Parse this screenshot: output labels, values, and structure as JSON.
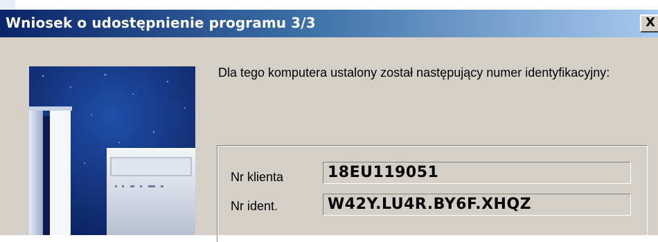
{
  "window": {
    "title": "Wniosek o udostępnienie programu 3/3",
    "close_label": "X"
  },
  "message": "Dla tego komputera ustalony został następujący numer identyfikacyjny:",
  "fields": [
    {
      "label": "Nr klienta",
      "value": "18EU119051"
    },
    {
      "label": "Nr ident.",
      "value": "W42Y.LU4R.BY6F.XHQZ"
    }
  ],
  "colors": {
    "title_start": "#0a246a",
    "title_end": "#a6caf0",
    "dialog_bg": "#d4d0c8"
  },
  "icons": [
    "close-icon"
  ]
}
